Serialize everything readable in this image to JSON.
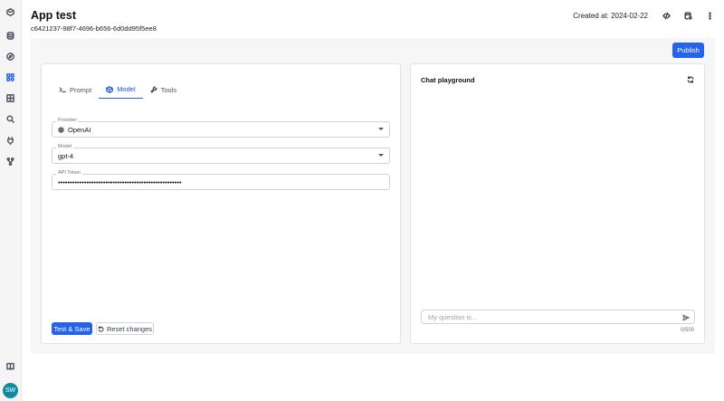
{
  "sidebar": {
    "items": [
      {
        "icon": "logo-icon"
      },
      {
        "icon": "database-icon"
      },
      {
        "icon": "compass-icon"
      },
      {
        "icon": "apps-icon",
        "active": true
      },
      {
        "icon": "grid-icon"
      },
      {
        "icon": "search-icon"
      },
      {
        "icon": "plug-icon"
      },
      {
        "icon": "fork-icon"
      },
      {
        "icon": "book-icon"
      }
    ],
    "avatar": "SW"
  },
  "header": {
    "title": "App test",
    "app_id": "c6421237-98f7-4696-b656-6d0dd95f5ee8",
    "created": "Created at: 2024-02-22"
  },
  "toolbar": {
    "publish_label": "Publish"
  },
  "tabs": [
    {
      "label": "Prompt",
      "icon": "terminal-icon"
    },
    {
      "label": "Model",
      "icon": "cube-icon",
      "active": true
    },
    {
      "label": "Tools",
      "icon": "wrench-icon"
    }
  ],
  "form": {
    "provider": {
      "label": "Provider",
      "value": "OpenAI"
    },
    "model": {
      "label": "Model",
      "value": "gpt-4"
    },
    "api_token": {
      "label": "API Token",
      "value": "••••••••••••••••••••••••••••••••••••••••••••••••••••"
    },
    "test_save_label": "Test & Save",
    "reset_label": "Reset changes"
  },
  "chat": {
    "title": "Chat playground",
    "placeholder": "My question is...",
    "counter": "0/500"
  },
  "colors": {
    "accent": "#2563eb",
    "avatar": "#0e8aa0"
  }
}
